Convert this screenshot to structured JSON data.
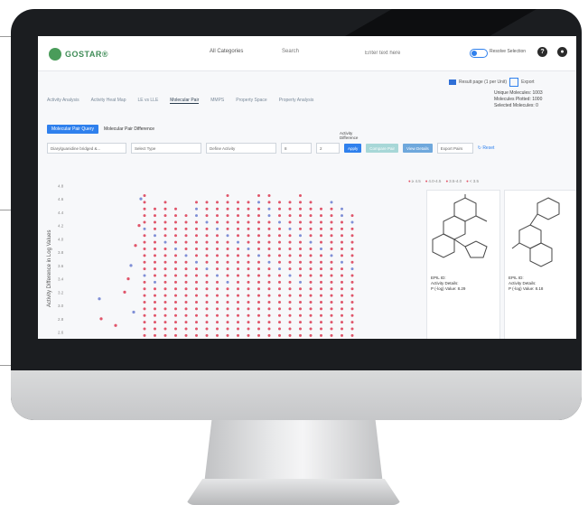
{
  "app": {
    "logo_text": "GOSTAR®",
    "category_select": "All Categories",
    "search_label": "Search",
    "search_placeholder": "Enter text here",
    "toggle_label": "Resolve Selection",
    "help_icon": "question-circle-icon",
    "user_icon": "user-circle-icon"
  },
  "result_bar": {
    "text": "Result page (1 per Unit) ",
    "export_label": "Export"
  },
  "tabs": [
    {
      "label": "Activity Analysis",
      "active": false
    },
    {
      "label": "Activity Heat Map",
      "active": false
    },
    {
      "label": "LE vs LLE",
      "active": false
    },
    {
      "label": "Molecular Pair",
      "active": true
    },
    {
      "label": "MMPS",
      "active": false
    },
    {
      "label": "Property Space",
      "active": false
    },
    {
      "label": "Property Analysis",
      "active": false
    }
  ],
  "stats": {
    "unique": "Unique Molecules: 1003",
    "plotted": "Molecules Plotted: 1000",
    "selected": "Selected Molecules: 0"
  },
  "subtabs": {
    "primary": "Molecular Pair Query",
    "secondary": "Molecular Pair Difference"
  },
  "filters": {
    "first": "Diarylguanidine bridged &...",
    "second": "Select Type",
    "third": "Define Activity",
    "fourth": "8",
    "diff_label_1": "Activity",
    "diff_label_2": "Difference",
    "diff_value": "2",
    "apply": "Apply",
    "compare": "Compare Pair",
    "details": "View Details",
    "export_sel": "Export Pairs",
    "reset": "Reset"
  },
  "chart": {
    "ylabel": "Activity Difference in Log Values",
    "yticks": [
      "4.8",
      "4.6",
      "4.4",
      "4.2",
      "4.0",
      "3.8",
      "3.6",
      "3.4",
      "3.2",
      "3.0",
      "2.8",
      "2.6"
    ],
    "colors": {
      "red": "#e0556a",
      "blue": "#7f8fd6"
    },
    "legend": [
      "≥ 4.5",
      "4.0-4.5",
      "3.5-4.0",
      "< 3.5"
    ]
  },
  "chart_data": {
    "type": "scatter",
    "ylabel": "Activity Difference in Log Values",
    "ylim": [
      2.5,
      4.9
    ],
    "series": [
      {
        "name": "",
        "color": "red"
      },
      {
        "name": "",
        "color": "blue"
      }
    ],
    "column_tops": [
      4.7,
      4.5,
      4.6,
      4.5,
      4.4,
      4.6,
      4.6,
      4.6,
      4.7,
      4.6,
      4.6,
      4.7,
      4.7,
      4.6,
      4.6,
      4.7,
      4.6,
      4.5,
      4.6,
      4.5,
      4.4
    ]
  },
  "cards": [
    {
      "id": "EPIL ID:",
      "details": "Activity Details:",
      "value": "P (-log) Value: 8.29"
    },
    {
      "id": "EPIL ID:",
      "details": "Activity Details:",
      "value": "P (-log) Value: 8.18"
    }
  ]
}
